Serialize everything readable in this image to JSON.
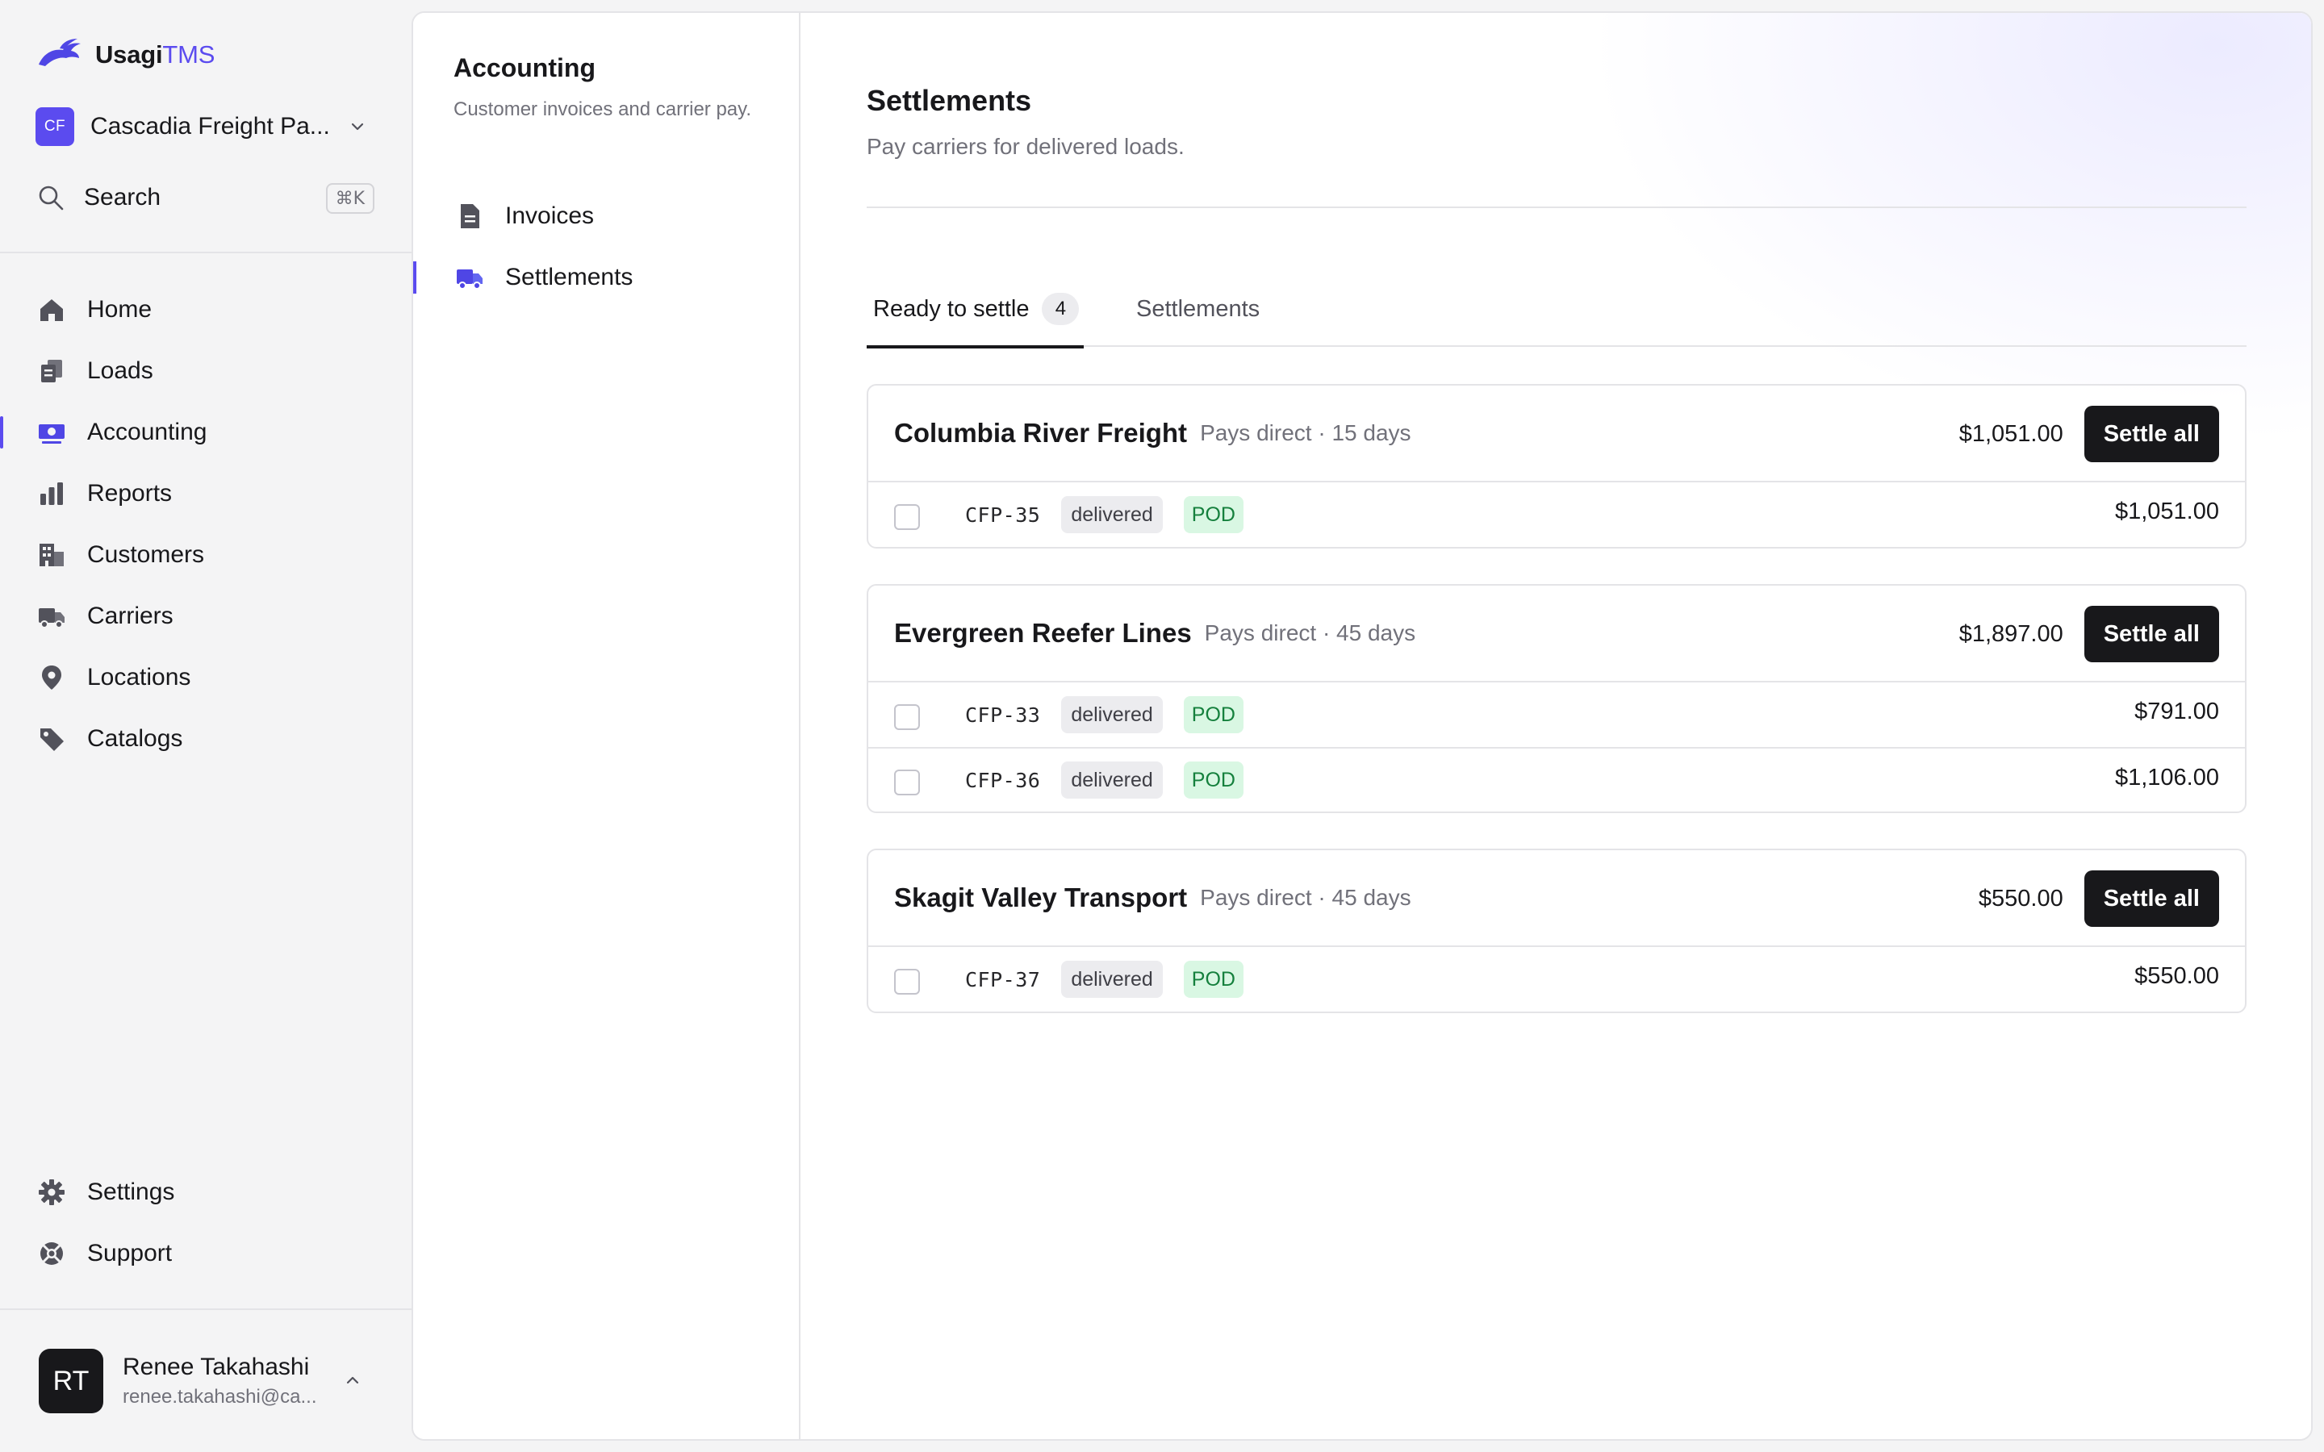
{
  "brand": {
    "name_main": "Usagi",
    "name_accent": "TMS"
  },
  "org": {
    "initials": "CF",
    "name": "Cascadia Freight Pa..."
  },
  "search": {
    "label": "Search",
    "shortcut": "⌘K"
  },
  "nav": {
    "items": [
      {
        "label": "Home",
        "icon": "home-icon"
      },
      {
        "label": "Loads",
        "icon": "loads-icon"
      },
      {
        "label": "Accounting",
        "icon": "accounting-icon",
        "active": true
      },
      {
        "label": "Reports",
        "icon": "bar-chart-icon"
      },
      {
        "label": "Customers",
        "icon": "building-icon"
      },
      {
        "label": "Carriers",
        "icon": "truck-icon"
      },
      {
        "label": "Locations",
        "icon": "map-pin-icon"
      },
      {
        "label": "Catalogs",
        "icon": "tag-icon"
      }
    ],
    "bottom": [
      {
        "label": "Settings",
        "icon": "gear-icon"
      },
      {
        "label": "Support",
        "icon": "lifebuoy-icon"
      }
    ]
  },
  "user": {
    "initials": "RT",
    "name": "Renee Takahashi",
    "email": "renee.takahashi@ca..."
  },
  "subnav": {
    "title": "Accounting",
    "description": "Customer invoices and carrier pay.",
    "items": [
      {
        "label": "Invoices",
        "icon": "document-icon"
      },
      {
        "label": "Settlements",
        "icon": "truck-icon",
        "active": true
      }
    ]
  },
  "page": {
    "title": "Settlements",
    "subtitle": "Pay carriers for delivered loads."
  },
  "tabs": [
    {
      "label": "Ready to settle",
      "count": "4",
      "active": true
    },
    {
      "label": "Settlements",
      "active": false
    }
  ],
  "groups": [
    {
      "carrier": "Columbia River Freight",
      "terms": "Pays direct · 15 days",
      "total": "$1,051.00",
      "action": "Settle all",
      "loads": [
        {
          "id": "CFP-35",
          "status": "delivered",
          "doc": "POD",
          "amount": "$1,051.00"
        }
      ]
    },
    {
      "carrier": "Evergreen Reefer Lines",
      "terms": "Pays direct · 45 days",
      "total": "$1,897.00",
      "action": "Settle all",
      "loads": [
        {
          "id": "CFP-33",
          "status": "delivered",
          "doc": "POD",
          "amount": "$791.00"
        },
        {
          "id": "CFP-36",
          "status": "delivered",
          "doc": "POD",
          "amount": "$1,106.00"
        }
      ]
    },
    {
      "carrier": "Skagit Valley Transport",
      "terms": "Pays direct · 45 days",
      "total": "$550.00",
      "action": "Settle all",
      "loads": [
        {
          "id": "CFP-37",
          "status": "delivered",
          "doc": "POD",
          "amount": "$550.00"
        }
      ]
    }
  ],
  "colors": {
    "accent": "#5b4bef",
    "primary_button": "#18181b",
    "pod_badge_bg": "#d9f7e3",
    "pod_badge_text": "#15803d"
  }
}
